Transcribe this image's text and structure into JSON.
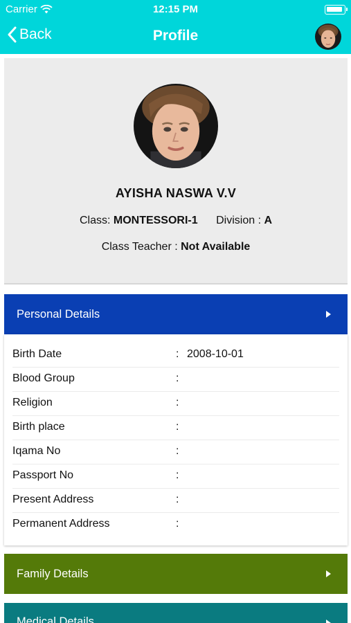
{
  "status_bar": {
    "carrier": "Carrier",
    "time": "12:15 PM",
    "icons": [
      "wifi-icon",
      "battery-icon"
    ]
  },
  "nav": {
    "back_label": "Back",
    "title": "Profile"
  },
  "profile": {
    "name": "AYISHA NASWA V.V",
    "class_label": "Class:",
    "class_value": "MONTESSORI-1",
    "division_label": "Division :",
    "division_value": "A",
    "teacher_label": "Class Teacher :",
    "teacher_value": "Not Available"
  },
  "sections": {
    "personal": "Personal Details",
    "family": "Family Details",
    "medical": "Medical Details"
  },
  "personal_details": [
    {
      "label": "Birth Date",
      "value": "2008-10-01"
    },
    {
      "label": "Blood Group",
      "value": ""
    },
    {
      "label": "Religion",
      "value": ""
    },
    {
      "label": "Birth place",
      "value": ""
    },
    {
      "label": "Iqama No",
      "value": ""
    },
    {
      "label": "Passport No",
      "value": ""
    },
    {
      "label": "Present Address",
      "value": ""
    },
    {
      "label": "Permanent Address",
      "value": ""
    }
  ],
  "colors": {
    "header": "#00d6da",
    "personal": "#0a3fb3",
    "family": "#547a09",
    "medical": "#0a7b80",
    "card": "#ececec"
  }
}
